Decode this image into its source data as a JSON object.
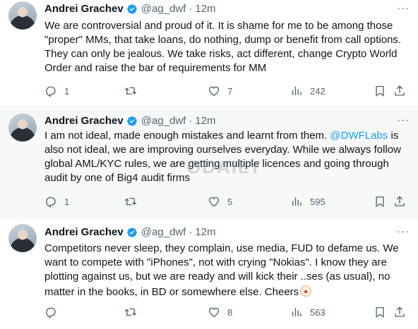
{
  "tweets": [
    {
      "name": "Andrei Grachev",
      "handle": "@ag_dwf",
      "time": "12m",
      "text": "We are controversial and proud of it. It is shame for me to be among those \"proper\" MMs, that take loans, do nothing, dump or benefit from call options. They can only be jealous. We take risks, act different, change Crypto World Order and raise the bar of requirements for MM",
      "replies": "1",
      "retweets": "",
      "likes": "7",
      "views": "242"
    },
    {
      "name": "Andrei Grachev",
      "handle": "@ag_dwf",
      "time": "12m",
      "text_before": "I am not ideal, made enough mistakes and learnt from them. ",
      "mention": "@DWFLabs",
      "text_after": " is also not ideal, we are improving ourselves everyday. While we always follow global AML/KYC rules, we are getting multiple licences and going through audit by one of Big4 audit firms",
      "replies": "1",
      "retweets": "",
      "likes": "5",
      "views": "595"
    },
    {
      "name": "Andrei Grachev",
      "handle": "@ag_dwf",
      "time": "12m",
      "text": "Competitors never sleep, they complain, use media, FUD to defame us. We want to compete with \"iPhones\", not with crying \"Nokias\". I know they are plotting against us, but we are ready and will kick their ..ses (as usual), no matter in the books, in BD or somewhere else. Cheers",
      "replies": "",
      "retweets": "",
      "likes": "8",
      "views": "563"
    }
  ],
  "watermark": "ODAILY",
  "icons": {
    "avatar": "avatar",
    "verified": "verified-badge-icon",
    "more": "more-icon",
    "reply": "reply-icon",
    "retweet": "retweet-icon",
    "like": "heart-icon",
    "views": "views-icon",
    "bookmark": "bookmark-icon",
    "share": "share-icon",
    "emoji": "clown-face-emoji"
  },
  "colors": {
    "accent": "#1d9bf0",
    "muted": "#536471",
    "text": "#0f1419",
    "highlight_bg": "#f7f9f9",
    "divider": "#eff3f4"
  }
}
